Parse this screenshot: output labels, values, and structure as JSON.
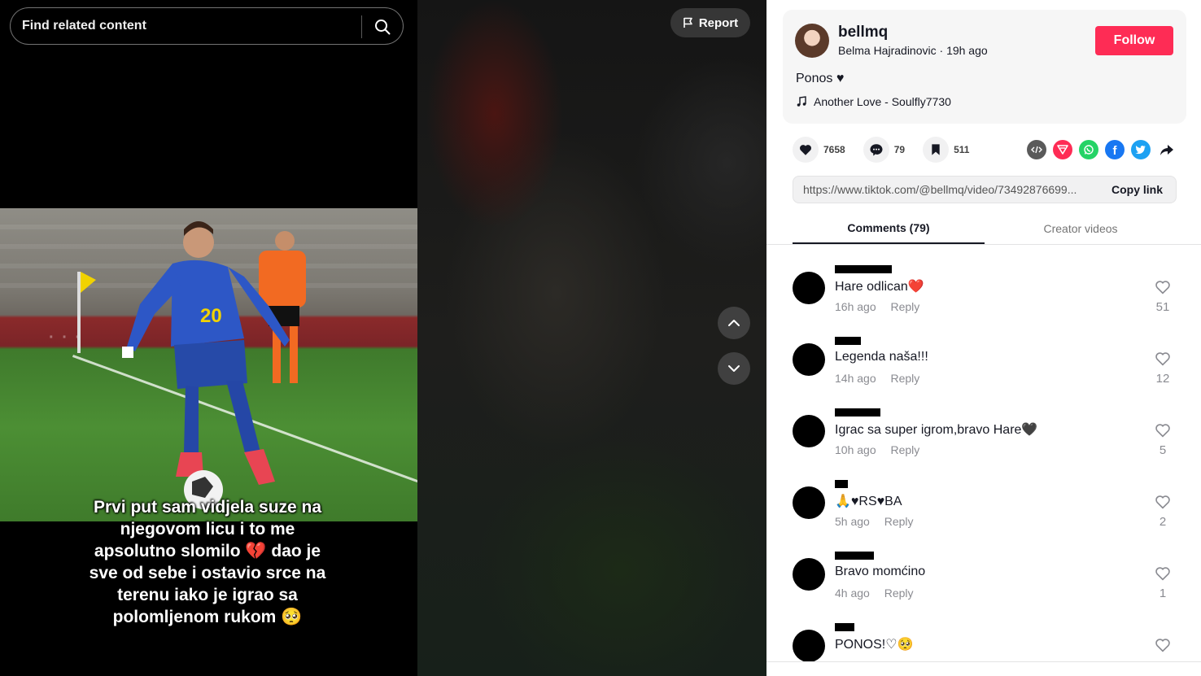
{
  "search": {
    "placeholder": "Find related content"
  },
  "video": {
    "report_label": "Report",
    "caption_lines": [
      "Prvi put sam vidjela suze na",
      "njegovom licu i to me",
      "apsolutno slomilo 💔 dao je",
      "sve od sebe i ostavio srce na",
      "terenu iako je igrao sa",
      "polomljenom rukom 🥺"
    ],
    "jersey_number": "20"
  },
  "author": {
    "username": "bellmq",
    "nickname": "Belma Hajradinovic",
    "posted": "19h ago",
    "follow_label": "Follow",
    "description": "Ponos ♥",
    "music": "Another Love - Soulfly7730"
  },
  "stats": {
    "likes": "7658",
    "comments": "79",
    "saves": "511"
  },
  "share": {
    "icons": [
      "embed-icon",
      "send-icon",
      "whatsapp-icon",
      "facebook-icon",
      "twitter-icon",
      "share-arrow-icon"
    ],
    "colors": {
      "send": "#fe2c55",
      "whatsapp": "#25d366",
      "facebook": "#1877f2",
      "twitter": "#1da1f2",
      "embed": "#5a5a5a"
    }
  },
  "link": {
    "url": "https://www.tiktok.com/@bellmq/video/73492876699...",
    "copy_label": "Copy link"
  },
  "tabs": {
    "comments": "Comments (79)",
    "creator": "Creator videos"
  },
  "comments": [
    {
      "text": "Hare odlican❤️",
      "time": "16h ago",
      "reply": "Reply",
      "likes": "51"
    },
    {
      "text": "Legenda naša!!!",
      "time": "14h ago",
      "reply": "Reply",
      "likes": "12"
    },
    {
      "text": "Igrac sa super igrom,bravo Hare🖤",
      "time": "10h ago",
      "reply": "Reply",
      "likes": "5"
    },
    {
      "text": "🙏♥RS♥BA",
      "time": "5h ago",
      "reply": "Reply",
      "likes": "2"
    },
    {
      "text": "Bravo momćino",
      "time": "4h ago",
      "reply": "Reply",
      "likes": "1"
    },
    {
      "text": "PONOS!♡🥺",
      "time": "",
      "reply": "",
      "likes": ""
    }
  ],
  "colors": {
    "accent": "#fe2c55",
    "text": "#161823",
    "muted": "#8a8b91"
  }
}
